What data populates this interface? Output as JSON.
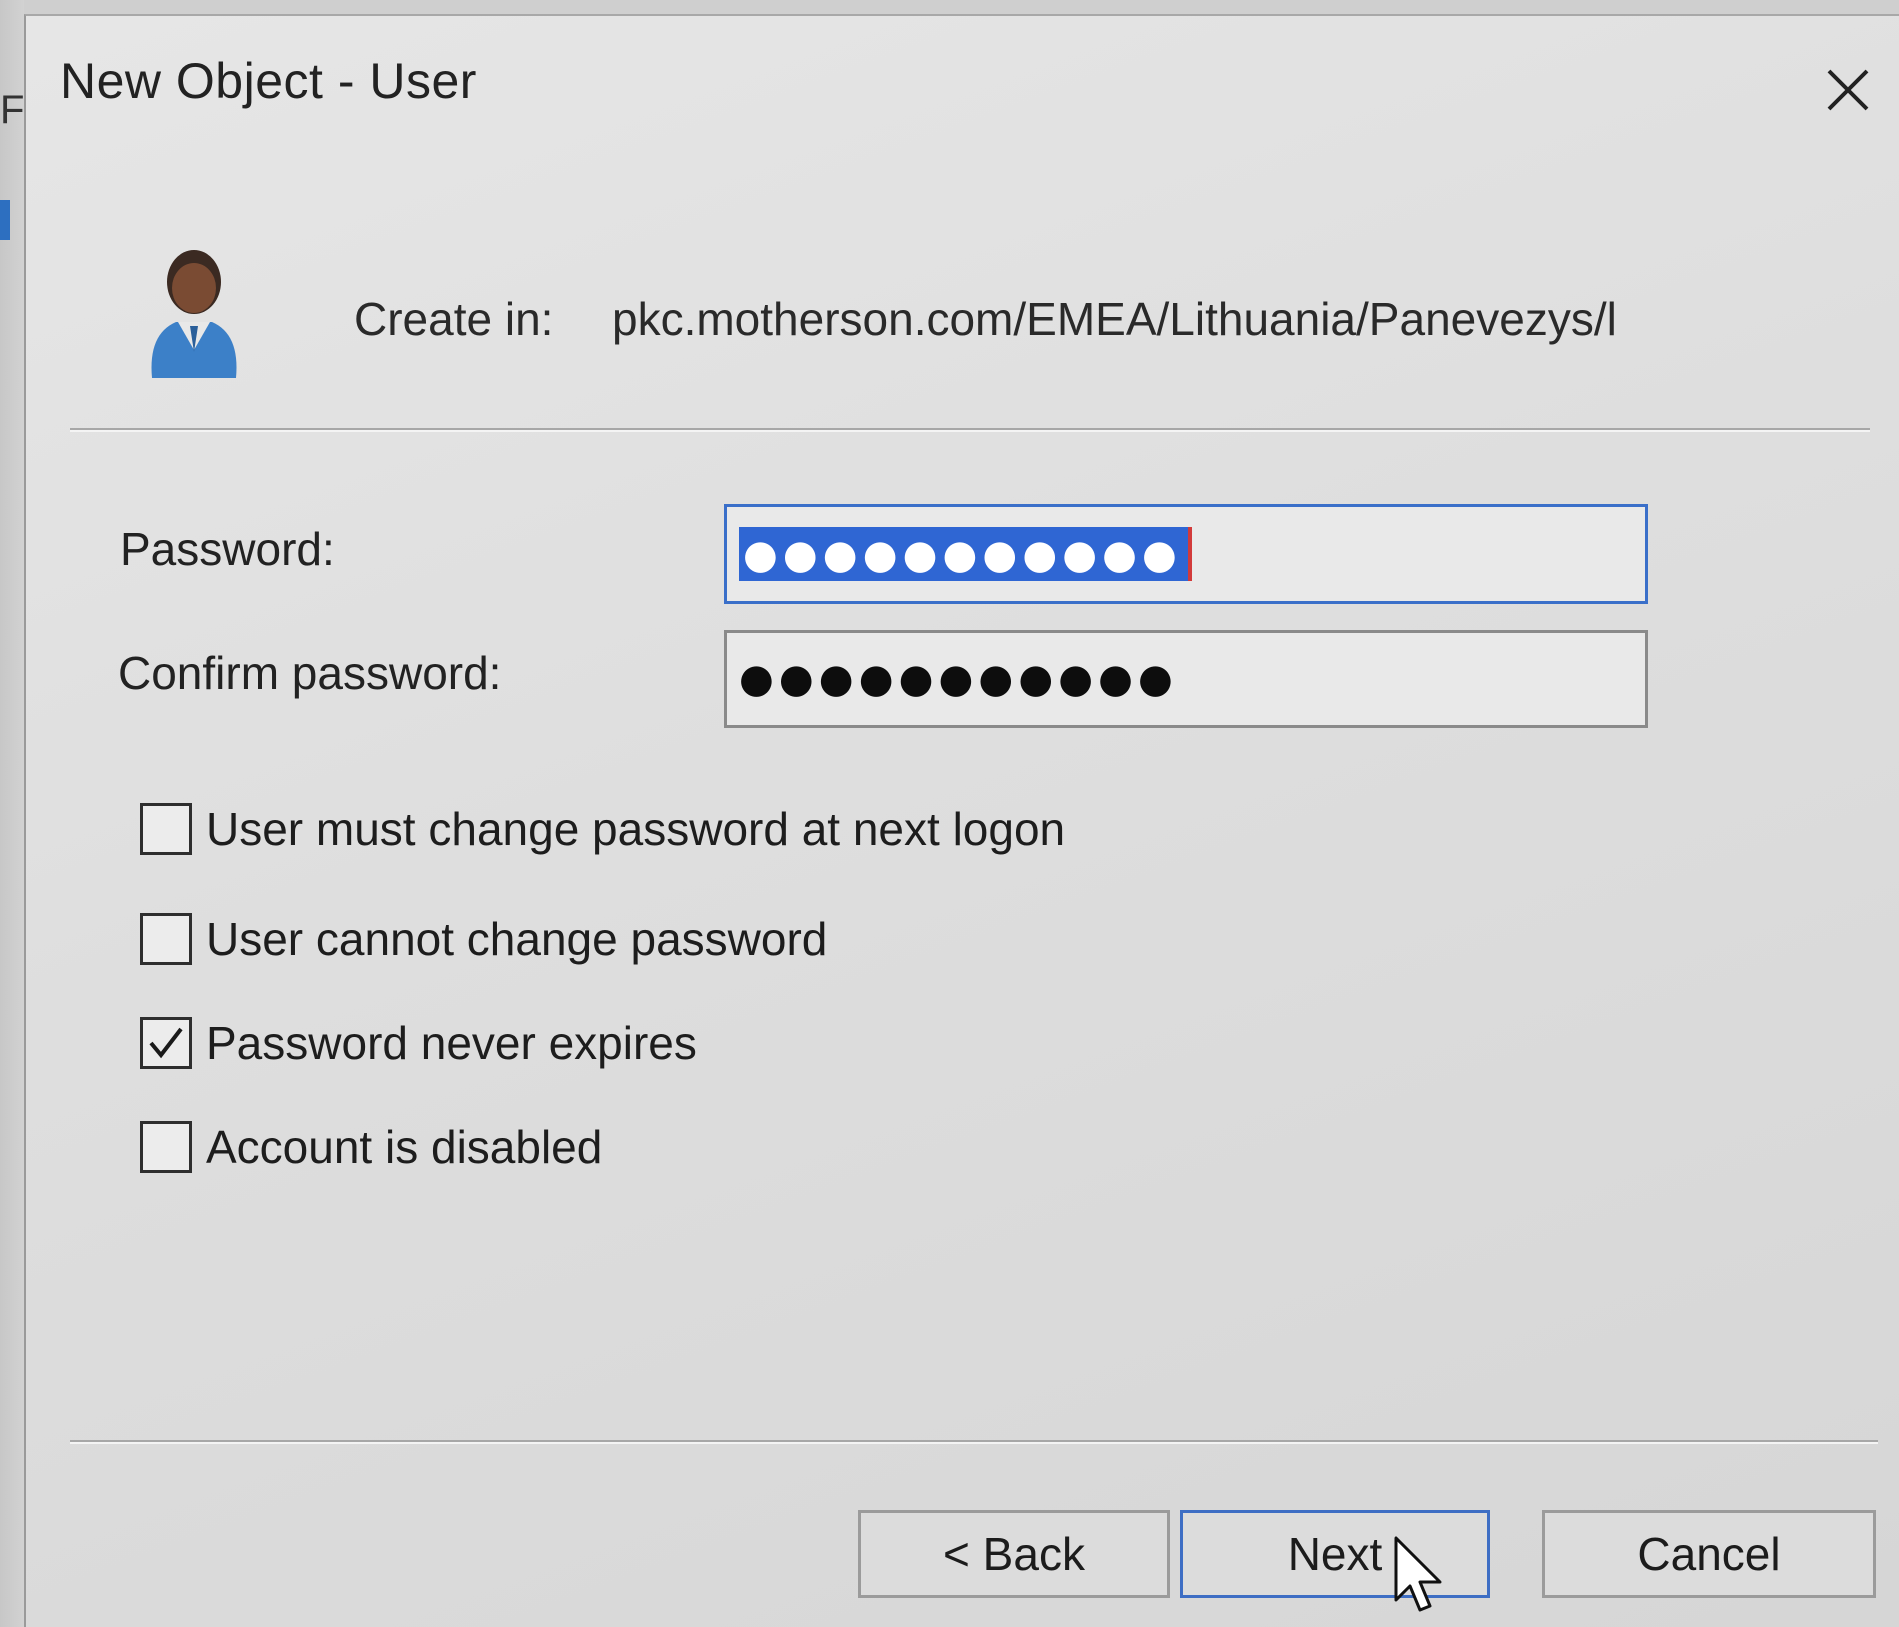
{
  "dialog": {
    "title": "New Object - User",
    "create_in_label": "Create in:",
    "create_in_path": "pkc.motherson.com/EMEA/Lithuania/Panevezys/l"
  },
  "fields": {
    "password_label": "Password:",
    "password_value": "●●●●●●●●●●●",
    "confirm_label": "Confirm password:",
    "confirm_value": "●●●●●●●●●●●"
  },
  "options": [
    {
      "label": "User must change password at next logon",
      "checked": false
    },
    {
      "label": "User cannot change password",
      "checked": false
    },
    {
      "label": "Password never expires",
      "checked": true
    },
    {
      "label": "Account is disabled",
      "checked": false
    }
  ],
  "buttons": {
    "back": "< Back",
    "next": "Next",
    "cancel": "Cancel"
  },
  "colors": {
    "focus_border": "#3a6fc9",
    "selection": "#2f66d3"
  },
  "icons": {
    "close": "close-icon",
    "user": "user-icon",
    "check": "checkmark-icon",
    "cursor": "mouse-pointer-icon"
  }
}
